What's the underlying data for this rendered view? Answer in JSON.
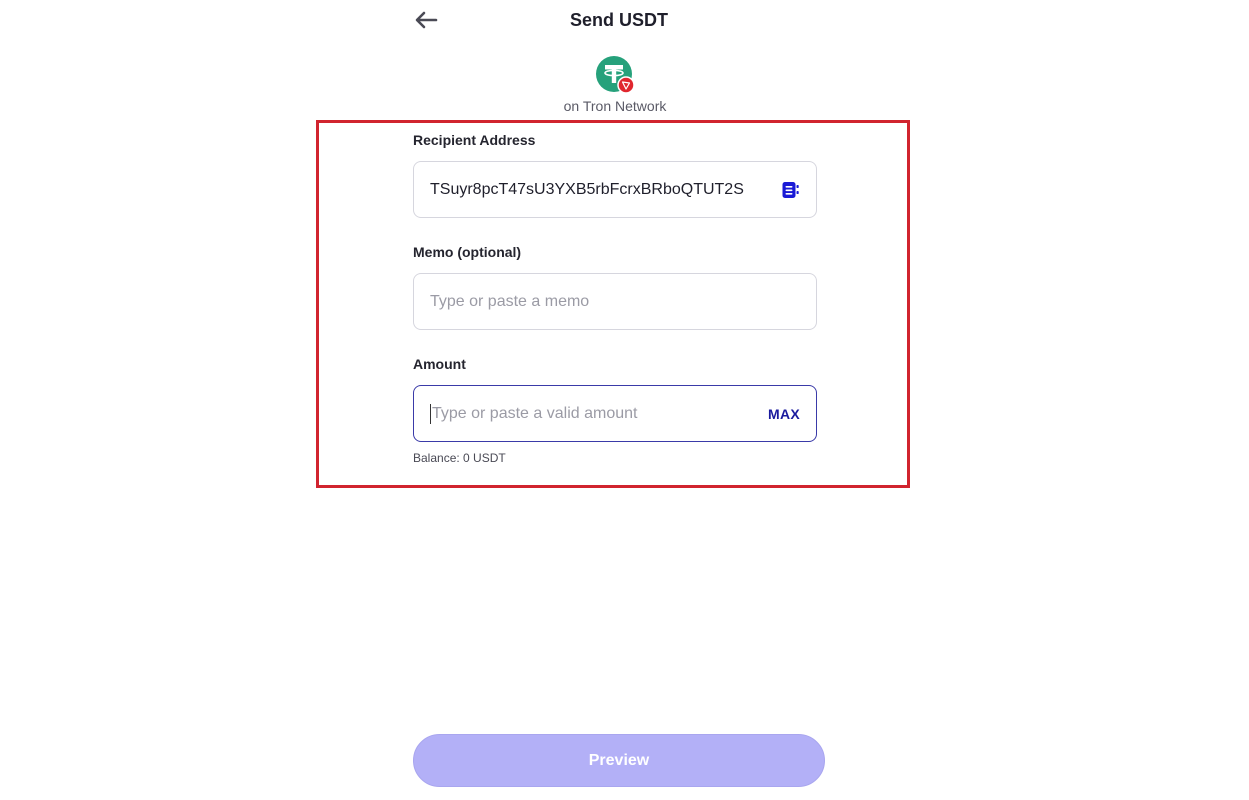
{
  "header": {
    "title": "Send USDT",
    "back_icon": "arrow-left-icon"
  },
  "token": {
    "logo_icon": "tether-logo-icon",
    "network_badge_icon": "tron-badge-icon",
    "network_label": "on Tron Network",
    "brand_color": "#26a17b",
    "network_color": "#e0262e"
  },
  "form": {
    "recipient": {
      "label": "Recipient Address",
      "value": "TSuyr8pcT47sU3YXB5rbFcrxBRboQTUT2S",
      "icon": "address-book-icon"
    },
    "memo": {
      "label": "Memo (optional)",
      "placeholder": "Type or paste a memo"
    },
    "amount": {
      "label": "Amount",
      "placeholder": "Type or paste a valid amount",
      "max_label": "MAX"
    },
    "balance": "Balance: 0 USDT"
  },
  "actions": {
    "preview_label": "Preview"
  },
  "colors": {
    "accent": "#1a1a9e",
    "highlight": "#d1242f",
    "button_disabled": "#b3b0f7"
  }
}
